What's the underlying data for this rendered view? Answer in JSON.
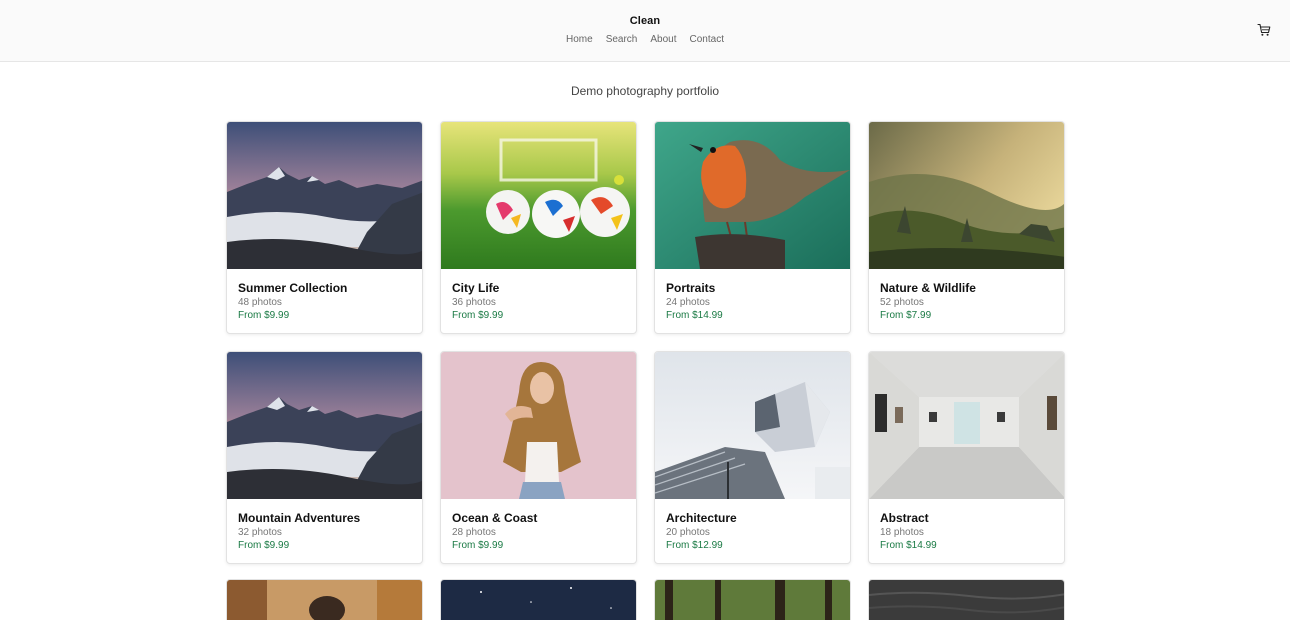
{
  "header": {
    "brand": "Clean",
    "nav": [
      "Home",
      "Search",
      "About",
      "Contact"
    ],
    "cart_icon": "cart-icon"
  },
  "subtitle": "Demo photography portfolio",
  "collections": [
    {
      "title": "Summer Collection",
      "count": "48 photos",
      "price": "From $9.99",
      "image": "mountain-sea-of-clouds"
    },
    {
      "title": "City Life",
      "count": "36 photos",
      "price": "From $9.99",
      "image": "soccer-balls-on-grass"
    },
    {
      "title": "Portraits",
      "count": "24 photos",
      "price": "From $14.99",
      "image": "robin-on-post"
    },
    {
      "title": "Nature & Wildlife",
      "count": "52 photos",
      "price": "From $7.99",
      "image": "misty-valley"
    },
    {
      "title": "Mountain Adventures",
      "count": "32 photos",
      "price": "From $9.99",
      "image": "mountain-sea-of-clouds"
    },
    {
      "title": "Ocean & Coast",
      "count": "28 photos",
      "price": "From $9.99",
      "image": "woman-pink-wall"
    },
    {
      "title": "Architecture",
      "count": "20 photos",
      "price": "From $12.99",
      "image": "modern-building"
    },
    {
      "title": "Abstract",
      "count": "18 photos",
      "price": "From $14.99",
      "image": "art-gallery-interior"
    }
  ],
  "partial_row": [
    "autumn-portrait",
    "night-sky",
    "forest",
    "dark-water"
  ]
}
